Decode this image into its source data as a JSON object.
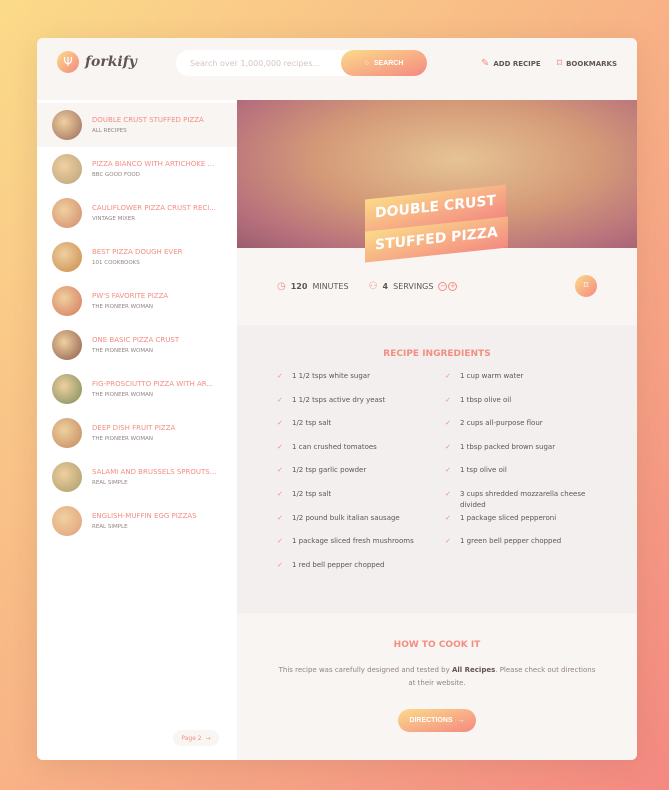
{
  "header": {
    "logo": "forkify",
    "search_placeholder": "Search over 1,000,000 recipes...",
    "search_label": "SEARCH",
    "add_recipe": "ADD RECIPE",
    "bookmarks": "BOOKMARKS"
  },
  "results": [
    {
      "title": "DOUBLE CRUST STUFFED PIZZA",
      "publisher": "ALL RECIPES",
      "color": "#9a6a5a"
    },
    {
      "title": "PIZZA BIANCO WITH ARTICHOKE ...",
      "publisher": "BBC GOOD FOOD",
      "color": "#b8a27a"
    },
    {
      "title": "CAULIFLOWER PIZZA CRUST RECI...",
      "publisher": "VINTAGE MIXER",
      "color": "#d08a6a"
    },
    {
      "title": "BEST PIZZA DOUGH EVER",
      "publisher": "101 COOKBOOKS",
      "color": "#c88a4a"
    },
    {
      "title": "PW'S FAVORITE PIZZA",
      "publisher": "THE PIONEER WOMAN",
      "color": "#d4765a"
    },
    {
      "title": "ONE BASIC PIZZA CRUST",
      "publisher": "THE PIONEER WOMAN",
      "color": "#8a5a4a"
    },
    {
      "title": "FIG-PROSCIUTTO PIZZA WITH AR...",
      "publisher": "THE PIONEER WOMAN",
      "color": "#7a8a5a"
    },
    {
      "title": "DEEP DISH FRUIT PIZZA",
      "publisher": "THE PIONEER WOMAN",
      "color": "#c0885a"
    },
    {
      "title": "SALAMI AND BRUSSELS SPROUTS...",
      "publisher": "REAL SIMPLE",
      "color": "#a89a6a"
    },
    {
      "title": "ENGLISH-MUFFIN EGG PIZZAS",
      "publisher": "REAL SIMPLE",
      "color": "#e0a07a"
    }
  ],
  "pagination": {
    "next": "Page 2"
  },
  "recipe": {
    "title_line1": "DOUBLE CRUST",
    "title_line2": "STUFFED PIZZA",
    "minutes": "120",
    "minutes_label": "MINUTES",
    "servings": "4",
    "servings_label": "SERVINGS"
  },
  "ingredients": {
    "title": "RECIPE INGREDIENTS",
    "items": [
      "1 1/2 tsps white sugar",
      "1 cup warm water",
      "1 1/2 tsps active dry yeast",
      "1 tbsp olive oil",
      "1/2 tsp salt",
      "2 cups all-purpose flour",
      "1 can crushed tomatoes",
      "1 tbsp packed brown sugar",
      "1/2 tsp garlic powder",
      "1 tsp olive oil",
      "1/2 tsp salt",
      "3 cups shredded mozzarella cheese divided",
      "1/2 pound bulk italian sausage",
      "1 package sliced pepperoni",
      "1 package sliced fresh mushrooms",
      "1 green bell pepper chopped",
      "1 red bell pepper chopped"
    ]
  },
  "cook": {
    "title": "HOW TO COOK IT",
    "text_before": "This recipe was carefully designed and tested by ",
    "publisher": "All Recipes",
    "text_after": ". Please check out directions at their website.",
    "button": "DIRECTIONS"
  }
}
